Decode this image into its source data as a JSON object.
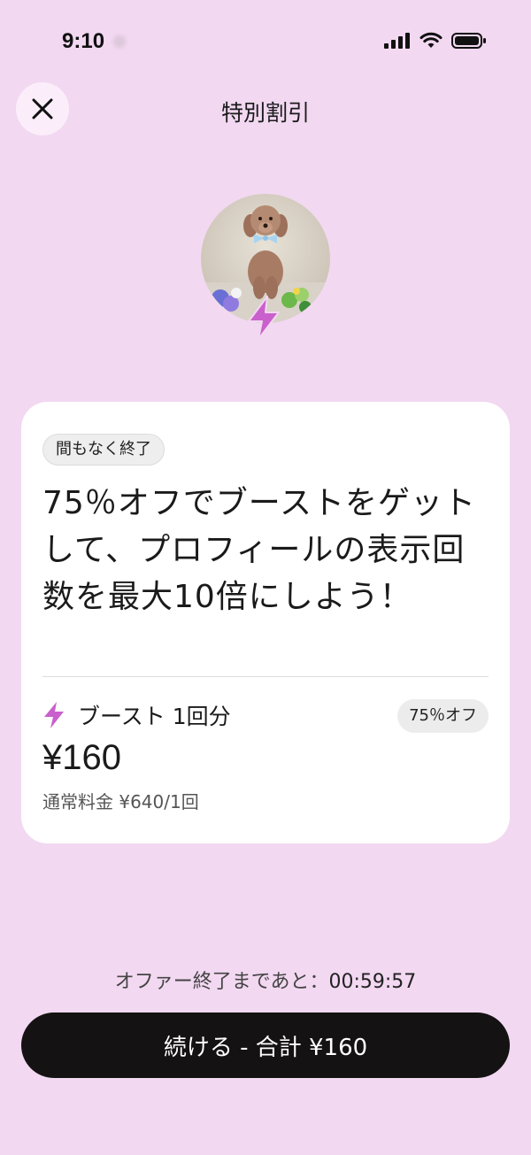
{
  "status_bar": {
    "time": "9:10"
  },
  "header": {
    "title": "特別割引",
    "close_icon": "close-icon"
  },
  "offer": {
    "ending_badge": "間もなく終了",
    "headline": "75％オフでブーストをゲットして、プロフィールの表示回数を最大10倍にしよう！",
    "item_label": "ブースト 1回分",
    "item_icon": "lightning-bolt-icon",
    "discount_badge": "75％オフ",
    "price": "¥160",
    "regular_price": "通常料金 ¥640/1回"
  },
  "countdown": {
    "label": "オファー終了まであと：",
    "time": "00:59:57"
  },
  "cta": {
    "label": "続ける - 合計 ¥160"
  },
  "colors": {
    "background": "#f2d8f1",
    "accent_bolt": "#c960cc",
    "cta_background": "#141212"
  }
}
